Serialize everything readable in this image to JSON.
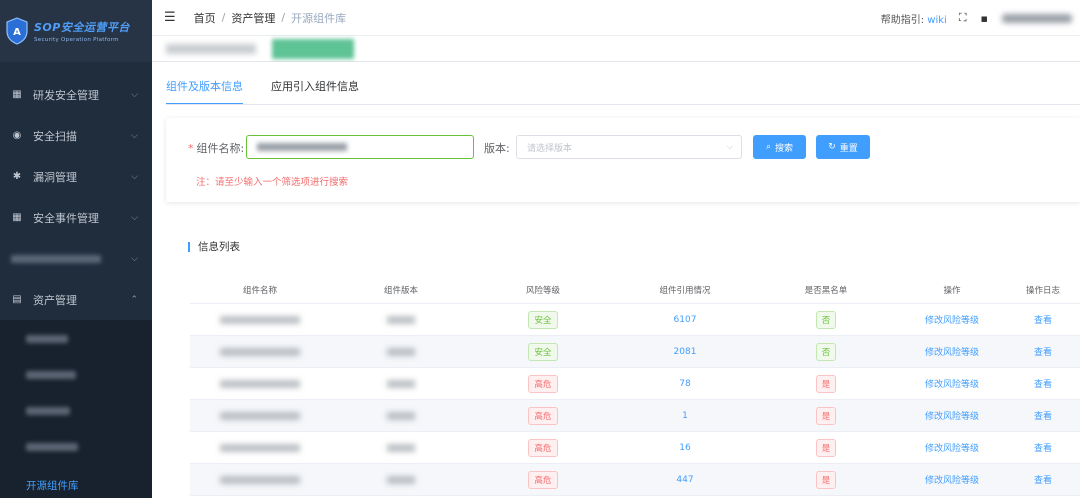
{
  "app": {
    "logo_title": "SOP安全运营平台",
    "logo_subtitle": "Security Operation Platform"
  },
  "sidebar": {
    "items": [
      {
        "label": "研发安全管理",
        "icon": "grid-icon"
      },
      {
        "label": "安全扫描",
        "icon": "eye-icon"
      },
      {
        "label": "漏洞管理",
        "icon": "bug-icon"
      },
      {
        "label": "安全事件管理",
        "icon": "grid-icon"
      },
      {
        "label": "",
        "icon": "blurred-icon"
      },
      {
        "label": "资产管理",
        "icon": "document-icon"
      }
    ],
    "active_sub": "开源组件库"
  },
  "header": {
    "breadcrumb": [
      "首页",
      "资产管理",
      "开源组件库"
    ],
    "help_label": "帮助指引:",
    "help_link": "wiki"
  },
  "tabs": [
    {
      "label": "组件及版本信息",
      "active": true
    },
    {
      "label": "应用引入组件信息",
      "active": false
    }
  ],
  "search": {
    "name_label": "组件名称:",
    "version_label": "版本:",
    "version_placeholder": "请选择版本",
    "search_button": "搜索",
    "reset_button": "重置",
    "note": "注：请至少输入一个筛选项进行搜索"
  },
  "list": {
    "title": "信息列表",
    "columns": [
      "组件名称",
      "组件版本",
      "风险等级",
      "组件引用情况",
      "是否黑名单",
      "操作",
      "操作日志"
    ],
    "rows": [
      {
        "risk": "安全",
        "risk_level": "safe",
        "refs": "6107",
        "blacklist": "否",
        "action": "修改风险等级",
        "log": "查看"
      },
      {
        "risk": "安全",
        "risk_level": "safe",
        "refs": "2081",
        "blacklist": "否",
        "action": "修改风险等级",
        "log": "查看"
      },
      {
        "risk": "高危",
        "risk_level": "high",
        "refs": "78",
        "blacklist": "是",
        "action": "修改风险等级",
        "log": "查看"
      },
      {
        "risk": "高危",
        "risk_level": "high",
        "refs": "1",
        "blacklist": "是",
        "action": "修改风险等级",
        "log": "查看"
      },
      {
        "risk": "高危",
        "risk_level": "high",
        "refs": "16",
        "blacklist": "是",
        "action": "修改风险等级",
        "log": "查看"
      },
      {
        "risk": "高危",
        "risk_level": "high",
        "refs": "447",
        "blacklist": "是",
        "action": "修改风险等级",
        "log": "查看"
      }
    ]
  },
  "colors": {
    "sidebar_bg": "#1f2d3d",
    "accent": "#409eff",
    "safe": "#67c23a",
    "danger": "#f56c6c"
  }
}
